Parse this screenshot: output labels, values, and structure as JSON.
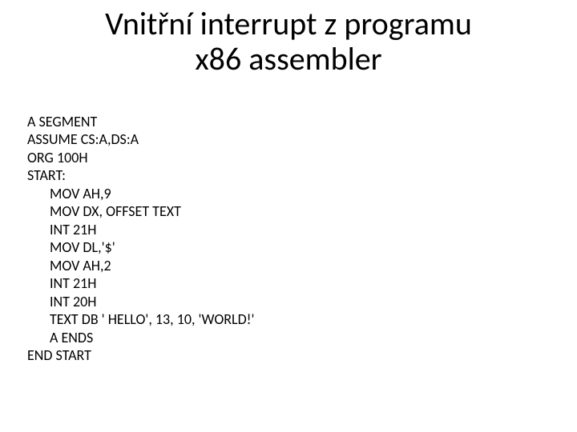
{
  "title_line1": "Vnitřní interrupt z programu",
  "title_line2": "x86 assembler",
  "code": {
    "l0": "A SEGMENT",
    "l1": "ASSUME CS:A,DS:A",
    "l2": "ORG 100H",
    "l3": "START:",
    "l4": "MOV AH,9",
    "l5": "MOV DX, OFFSET TEXT",
    "l6": "INT 21H",
    "l7": "MOV DL,'$'",
    "l8": "MOV AH,2",
    "l9": "INT 21H",
    "l10": "INT 20H",
    "l11": "TEXT DB ' HELLO', 13, 10, 'WORLD!'",
    "l12": "A ENDS",
    "l13": "END START"
  }
}
